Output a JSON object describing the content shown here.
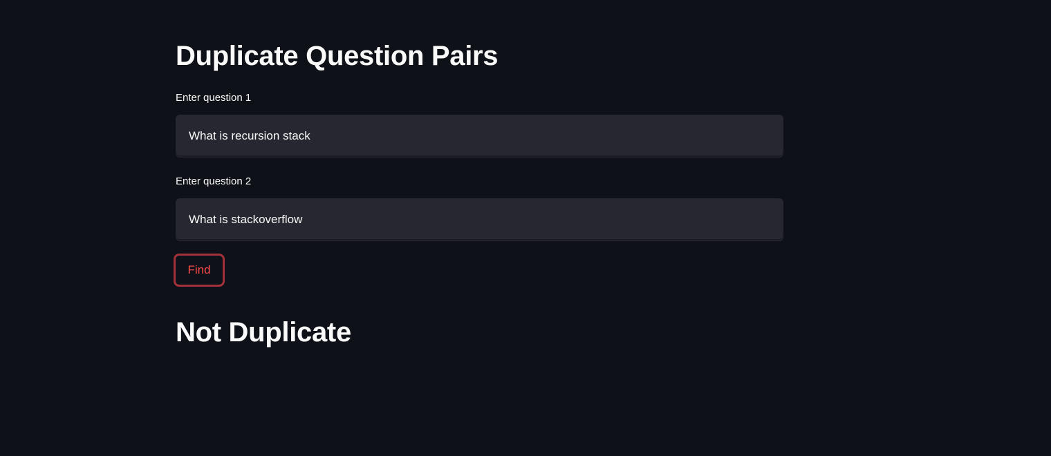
{
  "page": {
    "title": "Duplicate Question Pairs"
  },
  "form": {
    "question1": {
      "label": "Enter question 1",
      "value": "What is recursion stack"
    },
    "question2": {
      "label": "Enter question 2",
      "value": "What is stackoverflow"
    },
    "find_button_label": "Find"
  },
  "result": {
    "text": "Not Duplicate"
  },
  "colors": {
    "background": "#0e1117",
    "input_background": "#262730",
    "accent": "#ff4b4b",
    "text": "#fafafa"
  }
}
